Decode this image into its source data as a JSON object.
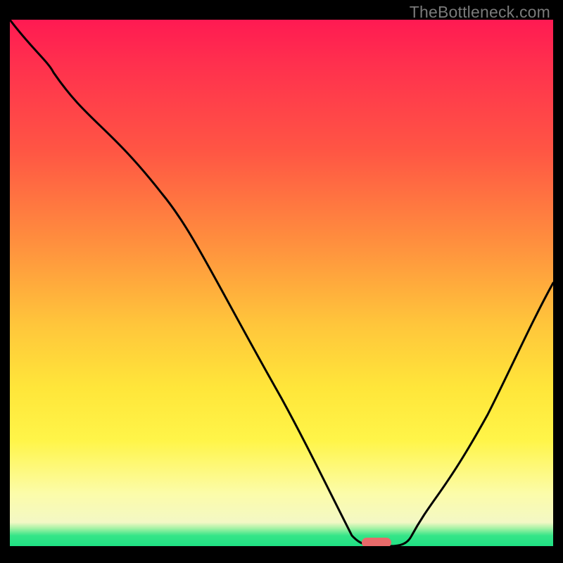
{
  "watermark": "TheBottleneck.com",
  "chart_data": {
    "type": "line",
    "title": "",
    "xlabel": "",
    "ylabel": "",
    "xlim": [
      0,
      100
    ],
    "ylim": [
      0,
      100
    ],
    "background_gradient": {
      "stops": [
        {
          "pos": 0,
          "color": "#ff1a52"
        },
        {
          "pos": 25,
          "color": "#ff5644"
        },
        {
          "pos": 58,
          "color": "#ffc63b"
        },
        {
          "pos": 80,
          "color": "#fff549"
        },
        {
          "pos": 95.5,
          "color": "#f3f8c5"
        },
        {
          "pos": 98,
          "color": "#35e588"
        },
        {
          "pos": 100,
          "color": "#1fe083"
        }
      ]
    },
    "series": [
      {
        "name": "bottleneck-curve",
        "x": [
          0,
          8,
          18,
          28,
          38,
          50,
          58,
          63,
          66,
          70,
          74,
          80,
          88,
          96,
          100
        ],
        "values": [
          100,
          90,
          80,
          67,
          50,
          28,
          12,
          2,
          0,
          0,
          2,
          10,
          25,
          42,
          50
        ]
      }
    ],
    "marker": {
      "x": 68,
      "y": 0,
      "shape": "capsule",
      "color": "#e86a6a"
    }
  }
}
